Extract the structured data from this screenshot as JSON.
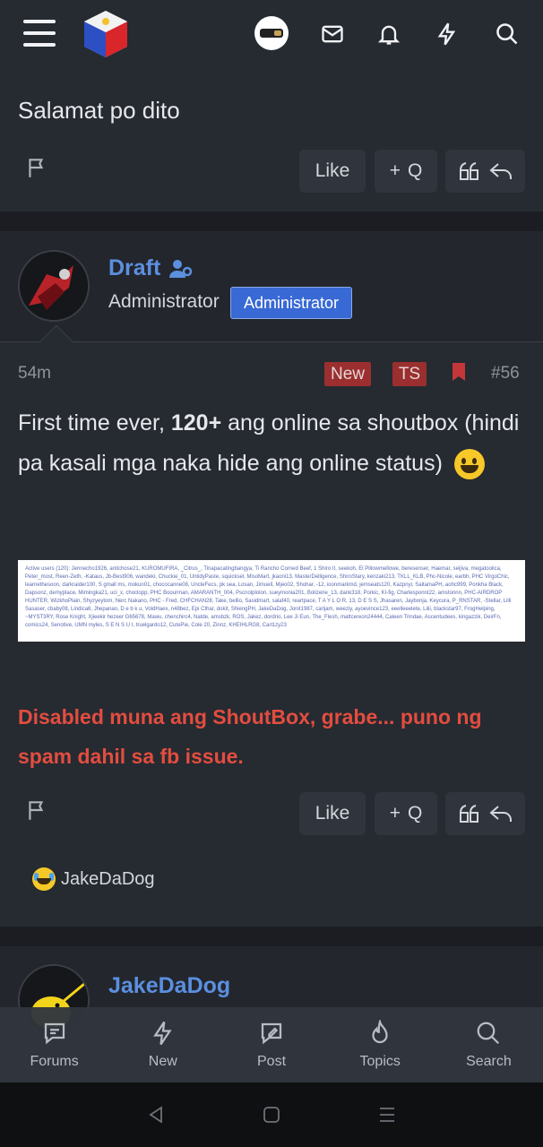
{
  "topbar": {
    "menu_icon": "hamburger-icon",
    "logo": "site-logo",
    "icons": [
      "avatar",
      "envelope-icon",
      "bell-icon",
      "bolt-icon",
      "search-icon"
    ]
  },
  "prev_post": {
    "text": "Salamat po dito",
    "actions": {
      "like": "Like",
      "quote": "Q"
    }
  },
  "post": {
    "username": "Draft",
    "role": "Administrator",
    "badge": "Administrator",
    "time": "54m",
    "tags": [
      "New",
      "TS"
    ],
    "number": "#56",
    "body_pre": "First time ever, ",
    "body_bold": "120+",
    "body_post": " ang online sa shoutbox (hindi pa kasali mga naka hide ang online status)",
    "shoutbox_snippet": "Active users (120): Jennecho1926, antichose21, KUROMUFIRA, _Citrus_, Tinapacatingbangya, Ti Rancho Corned Beef, 1 Shiro II, seekoh, El Pillowmellowe, beresenser, Haemar, seijiva, megatoolica, Peter_most, Reen-Zeth, -Kataus, Jb-Best906, wandeki, Chuckie_01, UntidyPaste, squicksel, MisoMart, jkaoni13, MasterDelligence, ShiroStary, kenzaki213, TKLL_KLB, Phc-Nicole, earbh, PHC VirgoChic, learnethesoon, darkraider100, S gmall ms, mokun01, chococanne08, UncleFecs, pk sea, Losan, Jimuell, Mjeo02, Shohar, -12, ioonmarkmd, jemseats120, Kazpnyi, SaitamaPH, aohc999, Ponkha Black, Dapsonz, demyplace, Mimingka21, uci_x, choclopp, PHC Boourman, AMARANTH_004, Pscnolplolon, sueymonia201, Bolizerie_13, dank318, Porkic, KI-fig, Charlesponnt22, amstonnn, PHC-AIRDROP HUNTER, WizkhoPlain, Shyzyeytom, Nerc Nakano, PHC - Fred, CHFCHAN28, Take, bellio, Sasidmart, salaf40, reartpace, T A Y L O R, 13, D E S S, Jhasaren, Jaybonja, Keycura, P_RNSTAR, -Stellar, Lilli Sasaser, cbaby08, Lindica6, Jhepanan, D e b k u, VoldHaex, n48bez, Epi Cthar, dokit, ShiengPH, JakeDaDog, Jonit1987, carljam, weeziy, ayoevince123, eeelleeelete, Lilii, blackstar97, FrogHelping, ~MYST3RY, Rose Knight, Xjieekir hezeer G65678, Mawu, chenchirc4, Natde, amsbzk, ROS, Jakez, dordrio, Lee Ji Eun, The_Flesh, mattcereon24444, Caleen Trindae, Ascentudees, kingazzik, DeirFn, comics24, Senotive, UMN myles, S E N S U I, truelgardo12, CutePie, Cole 20, Zinnz, KHEIHLRG8, Carl1zy23",
    "announcement": "Disabled muna ang ShoutBox, grabe... puno ng spam dahil sa fb issue.",
    "actions": {
      "like": "Like",
      "quote": "Q"
    },
    "reaction_user": "JakeDaDog"
  },
  "next_post": {
    "username": "JakeDaDog"
  },
  "bottom_nav": [
    {
      "label": "Forums",
      "icon": "forums-icon"
    },
    {
      "label": "New",
      "icon": "bolt-icon"
    },
    {
      "label": "Post",
      "icon": "post-icon"
    },
    {
      "label": "Topics",
      "icon": "flame-icon"
    },
    {
      "label": "Search",
      "icon": "search-icon"
    }
  ],
  "colors": {
    "accent": "#5b8fe0",
    "badge": "#3869d4",
    "announcement": "#e34d3f",
    "tag": "#9b2f2f"
  }
}
